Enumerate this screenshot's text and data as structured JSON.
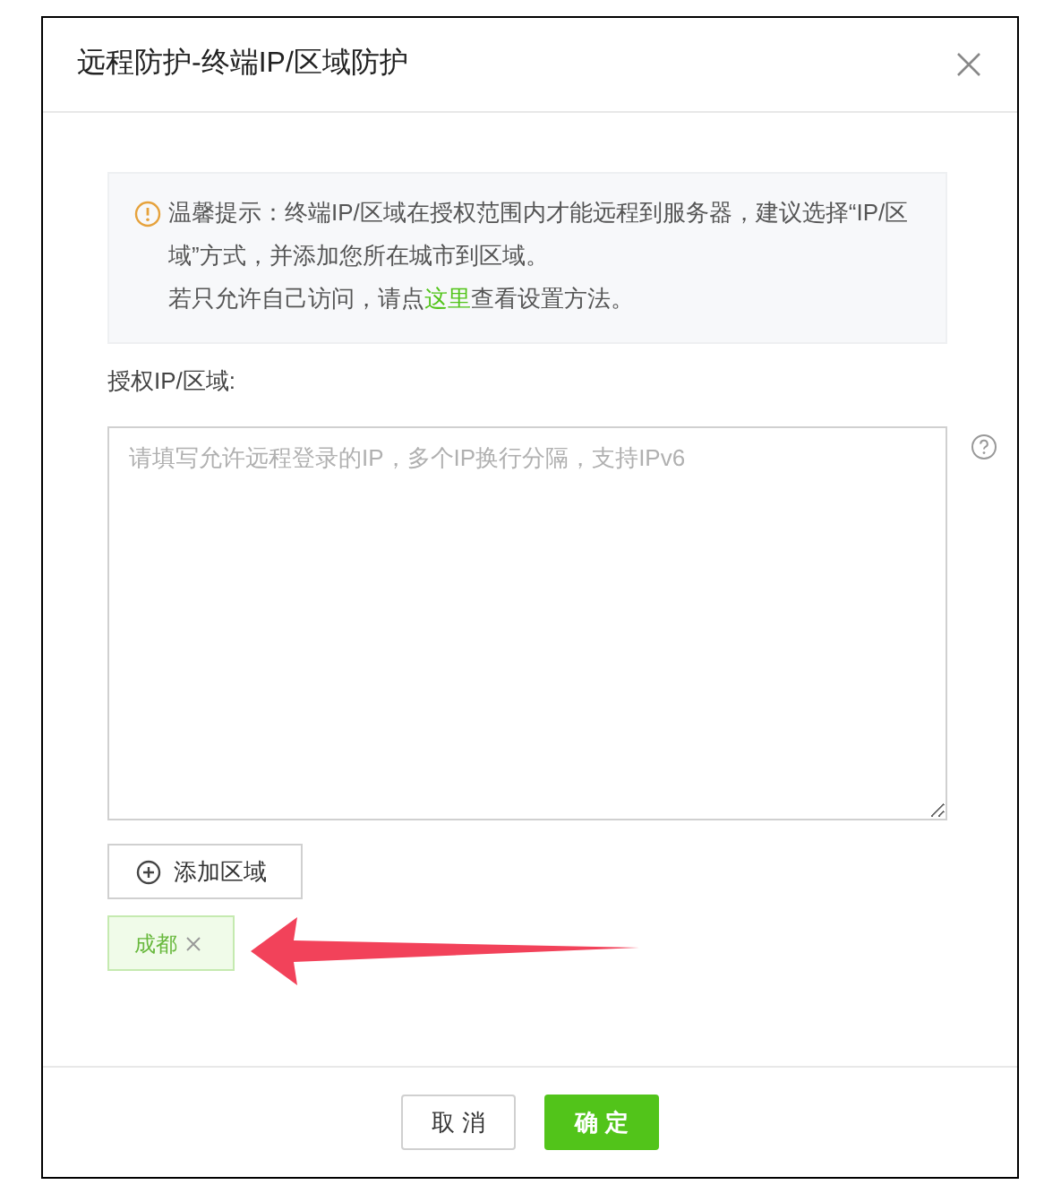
{
  "dialog": {
    "title": "远程防护-终端IP/区域防护"
  },
  "notice": {
    "text": "温馨提示：终端IP/区域在授权范围内才能远程到服务器，建议选择“IP/区域”方式，并添加您所在城市到区域。",
    "before_link": "若只允许自己访问，请点",
    "link": "这里",
    "after_link": "查看设置方法。"
  },
  "field": {
    "label": "授权IP/区域:",
    "placeholder": "请填写允许远程登录的IP，多个IP换行分隔，支持IPv6"
  },
  "add_button": "添加区域",
  "tags": [
    {
      "label": "成都"
    }
  ],
  "buttons": [
    {
      "label": "取 消",
      "kind": "default"
    },
    {
      "label": "确 定",
      "kind": "primary"
    }
  ]
}
